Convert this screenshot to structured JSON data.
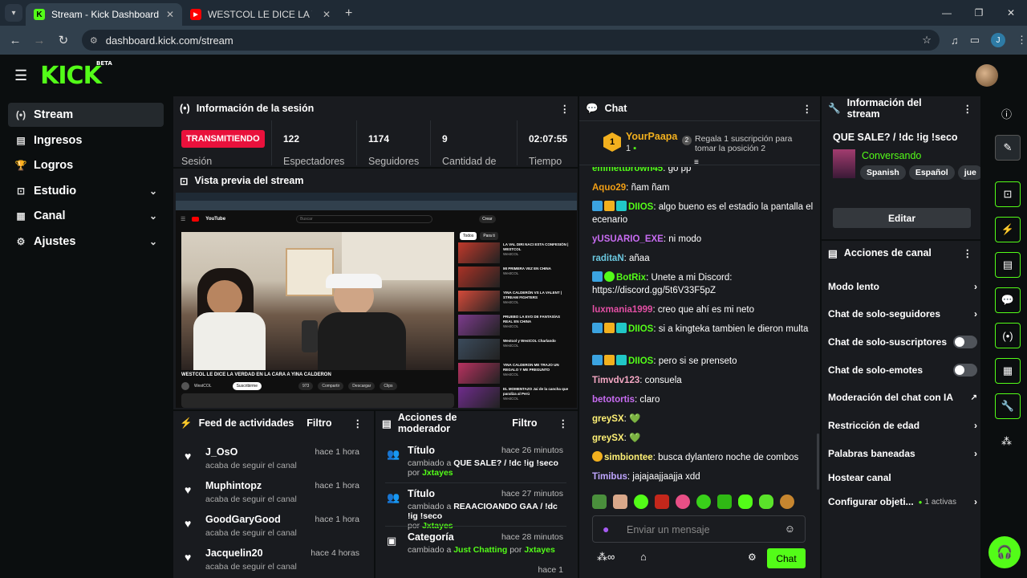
{
  "browser": {
    "tabs": [
      {
        "title": "Stream - Kick Dashboard",
        "active": true
      },
      {
        "title": "WESTCOL LE DICE LA VERD",
        "active": false
      }
    ],
    "url": "dashboard.kick.com/stream",
    "profile_initial": "J"
  },
  "brand": {
    "logo": "KICK",
    "beta": "BETA",
    "accent": "#53fc18"
  },
  "sidebar": {
    "items": [
      {
        "label": "Stream",
        "icon": "broadcast-icon",
        "active": true
      },
      {
        "label": "Ingresos",
        "icon": "chart-icon"
      },
      {
        "label": "Logros",
        "icon": "trophy-icon"
      },
      {
        "label": "Estudio",
        "icon": "studio-icon",
        "expandable": true
      },
      {
        "label": "Canal",
        "icon": "channel-icon",
        "expandable": true
      },
      {
        "label": "Ajustes",
        "icon": "gear-icon",
        "expandable": true
      }
    ]
  },
  "session": {
    "title": "Información de la sesión",
    "status": "TRANSMITIENDO",
    "session_label": "Sesión",
    "stats": [
      {
        "value": "122",
        "label": "Espectadores"
      },
      {
        "value": "1174",
        "label": "Seguidores"
      },
      {
        "value": "9",
        "label": "Cantidad de"
      },
      {
        "value": "02:07:55",
        "label": "Tiempo"
      }
    ]
  },
  "preview": {
    "title": "Vista previa del stream",
    "video_title": "WESTCOL LE DICE LA VERDAD EN LA CARA A YINA CALDERON",
    "channel": "WestCOL",
    "yt_logo": "YouTube",
    "yt_search": "Buscar",
    "yt_create": "Crear",
    "yt_subscribe": "Suscribirme",
    "yt_actions": [
      "973",
      "Compartir",
      "Descargar",
      "Clips"
    ],
    "yt_chips": [
      "Todos",
      "Para ti"
    ],
    "yt_related": [
      {
        "title": "LA VAL DIRI NACI ESTA CONFESIÓN | WESTCOL",
        "meta": "WestCOL"
      },
      {
        "title": "MI PRIMERA VEZ EN CHINA",
        "meta": "WestCOL"
      },
      {
        "title": "YINA CALDERÓN VS LA VALENT | STREAM FIGHTERS",
        "meta": "WestCOL"
      },
      {
        "title": "PRUEBO LA EVO DE FANTASÍAS REAL EN CHINA",
        "meta": "WestCOL"
      },
      {
        "title": "Westcol y WestCOL Charlando",
        "meta": "WestCOL"
      },
      {
        "title": "YINA CALDERON ME TRAJO UN REGALO Y ME PREGUNTO",
        "meta": "WestCOL"
      },
      {
        "title": "EL MOMENTAZO Jai de la cancha que paraliza al Perú",
        "meta": "WestCOL"
      }
    ]
  },
  "activity": {
    "title": "Feed de actividades",
    "filter": "Filtro",
    "items": [
      {
        "name": "J_OsO",
        "desc": "acaba de seguir el canal",
        "time": "hace 1 hora"
      },
      {
        "name": "Muphintopz",
        "desc": "acaba de seguir el canal",
        "time": "hace 1 hora"
      },
      {
        "name": "GoodGaryGood",
        "desc": "acaba de seguir el canal",
        "time": "hace 1 hora"
      },
      {
        "name": "Jacquelin20",
        "desc": "acaba de seguir el canal",
        "time": "hace 4 horas"
      }
    ]
  },
  "modactions": {
    "title": "Acciones de moderador",
    "filter": "Filtro",
    "items": [
      {
        "type": "Título",
        "time": "hace 26 minutos",
        "pre": "cambiado a ",
        "value": "QUE SALE? / !dc !ig !seco",
        "by": "por ",
        "user": "Jxtayes"
      },
      {
        "type": "Título",
        "time": "hace 27 minutos",
        "pre": "cambiado a ",
        "value": "REAACIOANDO GAA / !dc !ig !seco",
        "by": "por ",
        "user": "Jxtayes"
      },
      {
        "type": "Categoría",
        "time": "hace 28 minutos",
        "pre": "cambiado a ",
        "value": "Just Chatting",
        "by": " por ",
        "user": "Jxtayes"
      },
      {
        "type": "",
        "time": "hace 1",
        "pre": "",
        "value": "",
        "by": "",
        "user": ""
      }
    ]
  },
  "chat": {
    "title": "Chat",
    "pinned_user": "YourPaapa",
    "pinned_count": "1",
    "pinned_rank": "1",
    "gift_text": "Regala 1 suscripción para tomar la posición 2",
    "messages": [
      {
        "user": "emmettbrown45",
        "color": "#53fc18",
        "text": "go pp",
        "badges": []
      },
      {
        "user": "Aquo29",
        "color": "#f29f15",
        "text": "ñam ñam",
        "badges": []
      },
      {
        "user": "DIIOS",
        "color": "#53fc18",
        "text": "algo bueno es el estadio la pantalla el ecenario",
        "badges": [
          "vip",
          "crown",
          "sub"
        ]
      },
      {
        "user": "yUSUARIO_EXE",
        "color": "#c86cf2",
        "text": "ni modo",
        "badges": []
      },
      {
        "user": "raditaN",
        "color": "#6bc8e0",
        "text": "añaa",
        "badges": []
      },
      {
        "user": "BotRix",
        "color": "#53fc18",
        "text": "Unete a mi Discord: https://discord.gg/5t6V33F5pZ",
        "badges": [
          "vip",
          "verified"
        ]
      },
      {
        "user": "luxmania1999",
        "color": "#e34fa4",
        "text": "creo que ahí es mi neto",
        "badges": []
      },
      {
        "user": "DIIOS",
        "color": "#53fc18",
        "text": "si a kingteka tambien le dieron multa",
        "badges": [
          "vip",
          "crown",
          "sub"
        ]
      },
      {
        "user": "DIIOS",
        "color": "#53fc18",
        "text": "pero si se prenseto",
        "badges": [
          "vip",
          "crown",
          "sub"
        ]
      },
      {
        "user": "Timvdv123",
        "color": "#f4a7c3",
        "text": "consuela",
        "badges": []
      },
      {
        "user": "betotortis",
        "color": "#c86cf2",
        "text": "claro",
        "badges": []
      },
      {
        "user": "greySX",
        "color": "#fff176",
        "text": "💚",
        "badges": []
      },
      {
        "user": "greySX",
        "color": "#fff176",
        "text": "💚",
        "badges": []
      },
      {
        "user": "simbiontee",
        "color": "#fff176",
        "text": "busca dylantero noche de combos",
        "badges": [
          "gift"
        ]
      },
      {
        "user": "Timibus",
        "color": "#bfa6ff",
        "text": "jajajaajjaajja xdd",
        "badges": []
      }
    ],
    "input_placeholder": "Enviar un mensaje",
    "send_label": "Chat"
  },
  "streaminfo": {
    "title": "Información del stream",
    "stream_title": "QUE SALE? / !dc !ig !seco",
    "category": "Conversando",
    "tags": [
      "Spanish",
      "Español",
      "jue"
    ],
    "edit": "Editar"
  },
  "channelactions": {
    "title": "Acciones de canal",
    "items": [
      {
        "label": "Modo lento",
        "kind": "chevron"
      },
      {
        "label": "Chat de solo-seguidores",
        "kind": "chevron"
      },
      {
        "label": "Chat de solo-suscriptores",
        "kind": "toggle"
      },
      {
        "label": "Chat de solo-emotes",
        "kind": "toggle"
      },
      {
        "label": "Moderación del chat con IA",
        "kind": "external"
      },
      {
        "label": "Restricción de edad",
        "kind": "chevron"
      },
      {
        "label": "Palabras baneadas",
        "kind": "chevron"
      },
      {
        "label": "Hostear canal",
        "kind": "none"
      },
      {
        "label": "Configurar objeti...",
        "kind": "chevron",
        "extra": "1 activas"
      }
    ]
  }
}
